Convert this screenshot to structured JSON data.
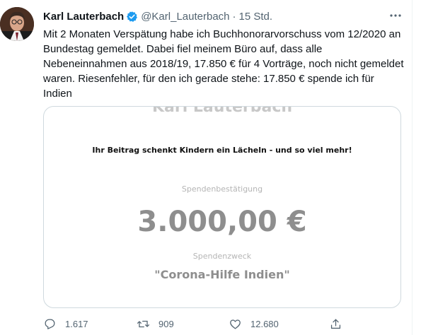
{
  "tweet": {
    "author_name": "Karl Lauterbach",
    "handle": "@Karl_Lauterbach",
    "separator": "·",
    "time": "15 Std.",
    "more_label": "···",
    "text": "Mit 2 Monaten Verspätung habe ich Buchhonorarvorschuss vom 12/2020 an\nBundestag gemeldet. Dabei fiel meinem Büro auf, dass alle\nNebeneinnahmen aus 2018/19, 17.850 € für 4 Vorträge, noch nicht gemeldet\nwaren. Riesenfehler, für den ich gerade stehe: 17.850 € spende ich für\nIndien"
  },
  "media": {
    "cut_name": "Karl Lauterbach",
    "headline": "Ihr Beitrag schenkt Kindern ein Lächeln - und so viel mehr!",
    "label_receipt": "Spendenbestätigung",
    "amount": "3.000,00 €",
    "label_purpose": "Spendenzweck",
    "purpose": "\"Corona-Hilfe Indien\""
  },
  "actions": {
    "replies": "1.617",
    "retweets": "909",
    "likes": "12.680"
  },
  "colors": {
    "verified": "#1d9bf0",
    "secondary_text": "#536471",
    "border": "#cfd9de"
  }
}
